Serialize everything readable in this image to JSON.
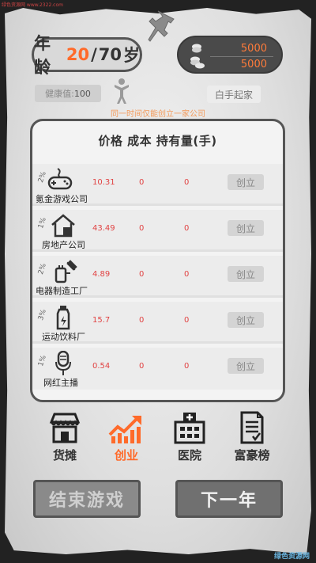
{
  "watermarks": {
    "top": "绿色资源网 www.2322.com",
    "bottom": "绿色资源网"
  },
  "status": {
    "age_label": "年龄",
    "age_current": "20",
    "age_sep": "/",
    "age_max": "70",
    "age_unit": "岁",
    "money1": "5000",
    "money2": "5000",
    "health_label": "健康值:",
    "health_value": "100",
    "start_tag": "白手起家",
    "notice": "同一时间仅能创立一家公司"
  },
  "table": {
    "headers": [
      "价格",
      "成本",
      "持有量(手)"
    ],
    "found_label": "创立",
    "rows": [
      {
        "name": "氪金游戏公司",
        "pct": "2%",
        "price": "10.31",
        "cost": "0",
        "hold": "0",
        "icon": "gamepad-icon"
      },
      {
        "name": "房地产公司",
        "pct": "1%",
        "price": "43.49",
        "cost": "0",
        "hold": "0",
        "icon": "house-icon"
      },
      {
        "name": "电器制造工厂",
        "pct": "2%",
        "price": "4.89",
        "cost": "0",
        "hold": "0",
        "icon": "appliance-icon"
      },
      {
        "name": "运动饮料厂",
        "pct": "3%",
        "price": "15.7",
        "cost": "0",
        "hold": "0",
        "icon": "bottle-icon"
      },
      {
        "name": "网红主播",
        "pct": "1%",
        "price": "0.54",
        "cost": "0",
        "hold": "0",
        "icon": "microphone-icon"
      }
    ]
  },
  "nav": [
    {
      "label": "货摊",
      "icon": "stall-icon",
      "active": false
    },
    {
      "label": "创业",
      "icon": "growth-chart-icon",
      "active": true
    },
    {
      "label": "医院",
      "icon": "hospital-icon",
      "active": false
    },
    {
      "label": "富豪榜",
      "icon": "leaderboard-icon",
      "active": false
    }
  ],
  "buttons": {
    "end": "结束游戏",
    "next": "下一年"
  },
  "colors": {
    "accent": "#ff6a2a",
    "value_red": "#e14343",
    "frame": "#555555"
  }
}
